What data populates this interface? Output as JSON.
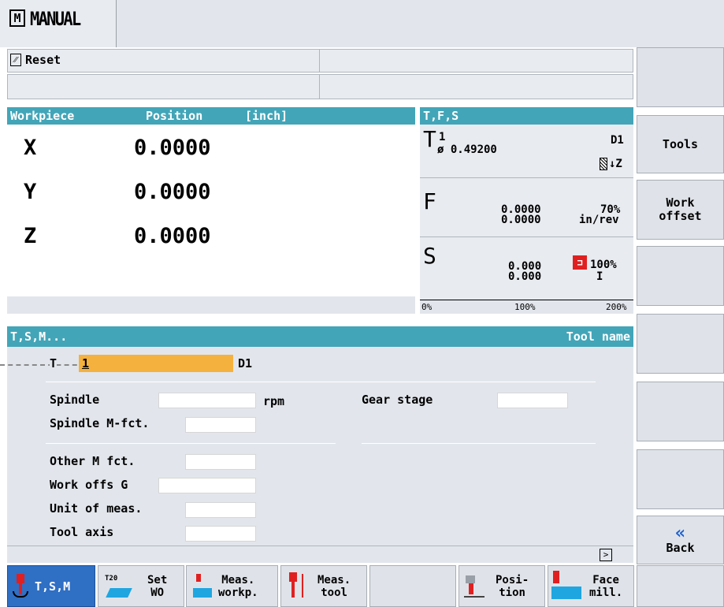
{
  "header": {
    "mode": "MANUAL",
    "channel_status": "Reset"
  },
  "workpiece": {
    "title": "Workpiece",
    "position_label": "Position",
    "unit": "[inch]",
    "axes": [
      {
        "name": "X",
        "value": "0.0000"
      },
      {
        "name": "Y",
        "value": "0.0000"
      },
      {
        "name": "Z",
        "value": "0.0000"
      }
    ]
  },
  "tfs": {
    "title": "T,F,S",
    "t_letter": "T",
    "tool_number": "1",
    "diameter": "ø 0.49200",
    "d_number": "D1",
    "axis": "↓Z",
    "f_letter": "F",
    "f_value1": "0.0000",
    "f_value2": "0.0000",
    "f_override": "70%",
    "f_unit": "in/rev",
    "s_letter": "S",
    "s_value1": "0.000",
    "s_value2": "0.000",
    "s_override": "100%",
    "s_gear": "I",
    "scale": [
      "0%",
      "100%",
      "200%"
    ]
  },
  "tsm": {
    "title": "T,S,M...",
    "tool_name_label": "Tool name",
    "t_label": "T",
    "tool_value": "1",
    "d_value": "D1",
    "spindle_label": "Spindle",
    "rpm_label": "rpm",
    "gear_stage_label": "Gear stage",
    "spindle_mfct_label": "Spindle M-fct.",
    "other_mfct_label": "Other M fct.",
    "work_offs_label": "Work offs G",
    "unit_meas_label": "Unit of meas.",
    "tool_axis_label": "Tool axis"
  },
  "vertical_softkeys": [
    "",
    "Tools",
    "Work\noffset",
    "",
    "",
    "",
    "",
    "Back"
  ],
  "back_arrows": "«",
  "horizontal_softkeys": [
    {
      "label": "T,S,M"
    },
    {
      "label": "Set\nWO"
    },
    {
      "label": "Meas.\nworkp."
    },
    {
      "label": "Meas.\ntool"
    },
    {
      "label": ""
    },
    {
      "label": "Posi-\ntion"
    },
    {
      "label": "Face\nmill."
    },
    {
      "label": ""
    }
  ],
  "icons": [
    "mode-manual-icon",
    "reset-icon",
    "tool-icon",
    "spindle-icon",
    "next-page-icon"
  ],
  "colors": {
    "header_bar": "#43a5b8",
    "tool_bar": "#f5b13d",
    "spindle_stop": "#e02020",
    "softkey_bg": "#dfe3e9"
  }
}
